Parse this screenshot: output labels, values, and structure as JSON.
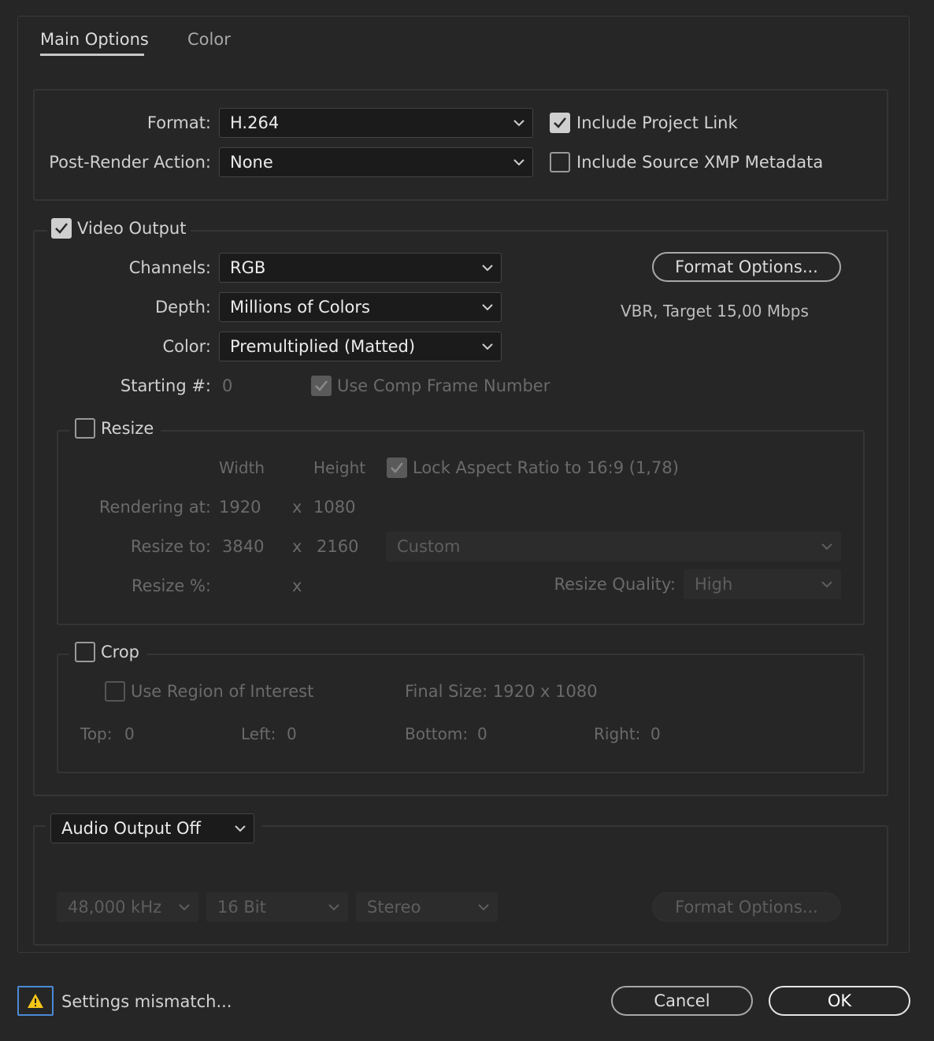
{
  "tabs": [
    {
      "label": "Main Options",
      "active": true
    },
    {
      "label": "Color",
      "active": false
    }
  ],
  "format_section": {
    "format_label": "Format:",
    "format_value": "H.264",
    "post_render_label": "Post-Render Action:",
    "post_render_value": "None",
    "include_project_link": {
      "label": "Include Project Link",
      "checked": true
    },
    "include_xmp": {
      "label": "Include Source XMP Metadata",
      "checked": false
    }
  },
  "video_output": {
    "label": "Video Output",
    "checked": true,
    "channels_label": "Channels:",
    "channels_value": "RGB",
    "depth_label": "Depth:",
    "depth_value": "Millions of Colors",
    "color_label": "Color:",
    "color_value": "Premultiplied (Matted)",
    "starting_label": "Starting #:",
    "starting_value": "0",
    "use_comp_frame": {
      "label": "Use Comp Frame Number",
      "checked": true
    },
    "format_options_button": "Format Options...",
    "format_summary": "VBR, Target 15,00 Mbps"
  },
  "resize": {
    "label": "Resize",
    "checked": false,
    "width_header": "Width",
    "height_header": "Height",
    "lock_aspect": {
      "label": "Lock Aspect Ratio to 16:9 (1,78)",
      "checked": true
    },
    "rendering_label": "Rendering at:",
    "rendering_width": "1920",
    "rendering_height": "1080",
    "resize_to_label": "Resize to:",
    "resize_to_width": "3840",
    "resize_to_height": "2160",
    "preset_value": "Custom",
    "percent_label": "Resize %:",
    "x_sep": "x",
    "quality_label": "Resize Quality:",
    "quality_value": "High"
  },
  "crop": {
    "label": "Crop",
    "checked": false,
    "roi": {
      "label": "Use Region of Interest",
      "checked": false
    },
    "final_size": "Final Size: 1920 x 1080",
    "top_label": "Top:",
    "top_value": "0",
    "left_label": "Left:",
    "left_value": "0",
    "bottom_label": "Bottom:",
    "bottom_value": "0",
    "right_label": "Right:",
    "right_value": "0"
  },
  "audio": {
    "output_value": "Audio Output Off",
    "sample_rate": "48,000 kHz",
    "bit_depth": "16 Bit",
    "channels": "Stereo",
    "format_options_button": "Format Options..."
  },
  "footer": {
    "warning_text": "Settings mismatch...",
    "cancel_label": "Cancel",
    "ok_label": "OK"
  },
  "colors": {
    "background": "#262626",
    "warning_border": "#4b8ad6",
    "warning_icon": "#f5c518"
  },
  "icons": [
    "warning-icon",
    "chevron-down-icon",
    "checkmark-icon"
  ]
}
